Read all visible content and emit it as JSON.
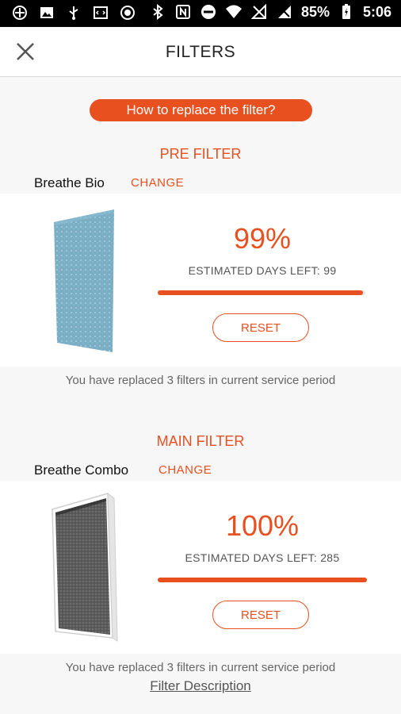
{
  "status_bar": {
    "battery_percent": "85%",
    "time": "5:06",
    "left_icons": [
      "vpn-icon",
      "image-icon",
      "usb-icon",
      "code-icon",
      "record-icon"
    ],
    "right_icons": [
      "bluetooth-icon",
      "nfc-icon",
      "dnd-icon",
      "wifi-icon",
      "cellular-off-icon",
      "signal-icon",
      "battery-icon"
    ]
  },
  "header": {
    "title": "FILTERS",
    "close_icon": "close-icon"
  },
  "howto_button": {
    "label": "How to replace the filter?"
  },
  "filters": [
    {
      "section_title": "PRE FILTER",
      "name": "Breathe Bio",
      "change_label": "CHANGE",
      "percent": "99%",
      "days_left": "ESTIMATED DAYS LEFT: 99",
      "progress": 0.99,
      "reset_label": "RESET",
      "replaced_note": "You have replaced 3 filters in current service period",
      "image": "pre-filter-image"
    },
    {
      "section_title": "MAIN FILTER",
      "name": "Breathe Combo",
      "change_label": "CHANGE",
      "percent": "100%",
      "days_left": "ESTIMATED DAYS LEFT: 285",
      "progress": 1.0,
      "reset_label": "RESET",
      "replaced_note": "You have replaced 3 filters in current service period",
      "image": "main-filter-image"
    }
  ],
  "footer": {
    "description_link": "Filter Description"
  },
  "colors": {
    "accent": "#e8501f",
    "background": "#f7f7f7",
    "card": "#ffffff",
    "statusbar": "#000000"
  }
}
